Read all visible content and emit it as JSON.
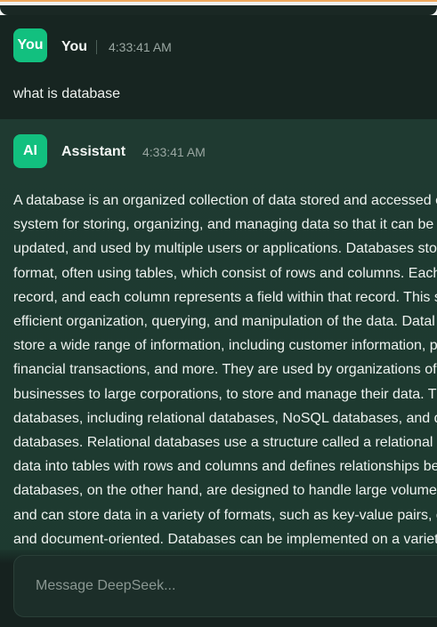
{
  "user_message": {
    "avatar": "You",
    "sender": "You",
    "timestamp": "4:33:41 AM",
    "text": "what is database"
  },
  "assistant_message": {
    "avatar": "AI",
    "sender": "Assistant",
    "timestamp": "4:33:41 AM",
    "lines": [
      "A database is an organized collection of data stored and accessed e",
      "system for storing, organizing, and managing data so that it can be",
      "updated, and used by multiple users or applications. Databases stor",
      "format, often using tables, which consist of rows and columns. Each",
      "record, and each column represents a field within that record. This s",
      "efficient organization, querying, and manipulation of the data. Datal",
      "store a wide range of information, including customer information, p",
      "financial transactions, and more. They are used by organizations of a",
      "businesses to large corporations, to store and manage their data. Th",
      "databases, including relational databases, NoSQL databases, and do",
      "databases. Relational databases use a structure called a relational m",
      "data into tables with rows and columns and defines relationships be",
      "databases, on the other hand, are designed to handle large volumes",
      "and can store data in a variety of formats, such as key-value pairs, c",
      "and document-oriented. Databases can be implemented on a variet"
    ]
  },
  "composer": {
    "placeholder": "Message DeepSeek..."
  },
  "colors": {
    "accent": "#12c07f",
    "background": "#1a2824"
  }
}
